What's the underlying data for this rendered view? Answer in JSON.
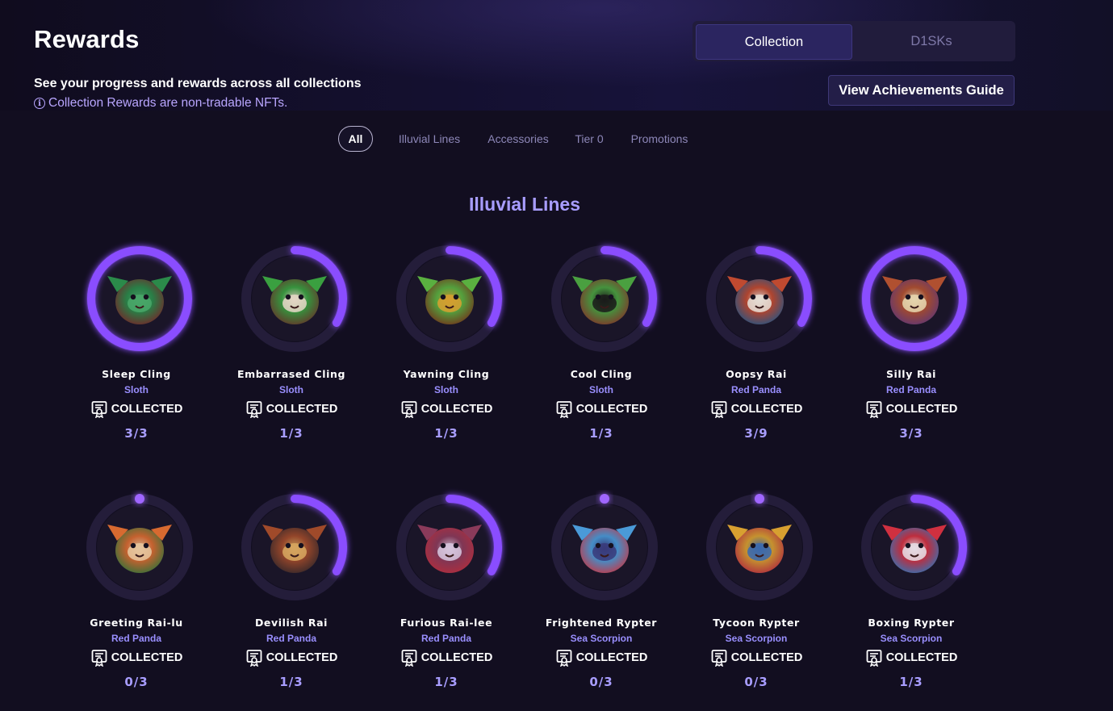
{
  "header": {
    "title": "Rewards",
    "subtitle": "See your progress and rewards across all collections",
    "info": "Collection Rewards are non-tradable NFTs."
  },
  "view_toggle": {
    "active": "Collection",
    "inactive": "D1SKs"
  },
  "guide_button": "View Achievements Guide",
  "filters": [
    "All",
    "Illuvial Lines",
    "Accessories",
    "Tier 0",
    "Promotions"
  ],
  "section_title": "Illuvial Lines",
  "colors": {
    "accent": "#8a4dff",
    "accent_glow": "#a066ff",
    "ring_track": "#241d3a",
    "type_text": "#9a8fff"
  },
  "cards": [
    {
      "name": "Sleep Cling",
      "type": "Sloth",
      "status": "COLLECTED",
      "count": "3/3",
      "collected": 3,
      "total": 3,
      "art": [
        "#2b8a4a",
        "#7a2a2a",
        "#4aa86a"
      ]
    },
    {
      "name": "Embarrased Cling",
      "type": "Sloth",
      "status": "COLLECTED",
      "count": "1/3",
      "collected": 1,
      "total": 3,
      "art": [
        "#3aa040",
        "#6b3a2a",
        "#e8d8c8"
      ]
    },
    {
      "name": "Yawning Cling",
      "type": "Sloth",
      "status": "COLLECTED",
      "count": "1/3",
      "collected": 1,
      "total": 3,
      "art": [
        "#5ab040",
        "#7a3a1a",
        "#d8a030"
      ]
    },
    {
      "name": "Cool Cling",
      "type": "Sloth",
      "status": "COLLECTED",
      "count": "1/3",
      "collected": 1,
      "total": 3,
      "art": [
        "#4aa040",
        "#8a3a2a",
        "#1a1a1a"
      ]
    },
    {
      "name": "Oopsy Rai",
      "type": "Red Panda",
      "status": "COLLECTED",
      "count": "3/9",
      "collected": 3,
      "total": 9,
      "art": [
        "#c04a30",
        "#2a5a8a",
        "#e8e0d8"
      ]
    },
    {
      "name": "Silly Rai",
      "type": "Red Panda",
      "status": "COLLECTED",
      "count": "3/3",
      "collected": 3,
      "total": 3,
      "art": [
        "#b05030",
        "#6a3a7a",
        "#e8d8b0"
      ]
    },
    {
      "name": "Greeting Rai-lu",
      "type": "Red Panda",
      "status": "COLLECTED",
      "count": "0/3",
      "collected": 0,
      "total": 3,
      "art": [
        "#d86a30",
        "#3a7a3a",
        "#e8c8a0"
      ]
    },
    {
      "name": "Devilish Rai",
      "type": "Red Panda",
      "status": "COLLECTED",
      "count": "1/3",
      "collected": 1,
      "total": 3,
      "art": [
        "#a04a2a",
        "#3a2a2a",
        "#d8a860"
      ]
    },
    {
      "name": "Furious Rai-lee",
      "type": "Red Panda",
      "status": "COLLECTED",
      "count": "1/3",
      "collected": 1,
      "total": 3,
      "art": [
        "#8a3a5a",
        "#c03040",
        "#d8c8e0"
      ]
    },
    {
      "name": "Frightened Rypter",
      "type": "Sea Scorpion",
      "status": "COLLECTED",
      "count": "0/3",
      "collected": 0,
      "total": 3,
      "art": [
        "#4a9ad8",
        "#d04050",
        "#3a3a7a"
      ]
    },
    {
      "name": "Tycoon Rypter",
      "type": "Sea Scorpion",
      "status": "COLLECTED",
      "count": "0/3",
      "collected": 0,
      "total": 3,
      "art": [
        "#d8a030",
        "#c03040",
        "#3a6ab0"
      ]
    },
    {
      "name": "Boxing Rypter",
      "type": "Sea Scorpion",
      "status": "COLLECTED",
      "count": "1/3",
      "collected": 1,
      "total": 3,
      "art": [
        "#d03040",
        "#3a7ac0",
        "#e8e0e8"
      ]
    }
  ]
}
